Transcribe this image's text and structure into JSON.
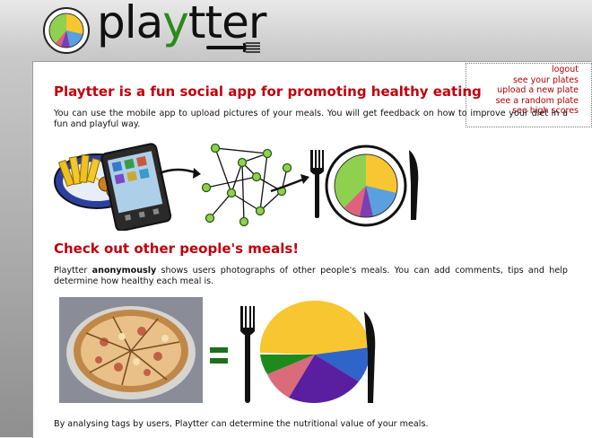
{
  "app": {
    "logo_text_a": "pla",
    "logo_text_y": "y",
    "logo_text_b": "tter",
    "logo_icon": "pie-plate-logo-icon",
    "fork_icon": "fork-icon"
  },
  "menu": {
    "logout": "logout",
    "see_plates": "see your plates",
    "upload": "upload a new plate",
    "random": "see a random plate",
    "scores": "see high scores"
  },
  "section1": {
    "heading": "Playtter is a fun social app for promoting healthy eating",
    "body": "You can use the mobile app to upload pictures of your meals. You will get feedback on how to improve your diet in a fun and playful way."
  },
  "section2": {
    "heading": "Check out other people's meals!",
    "body_pre": "Playtter ",
    "body_bold": "anonymously",
    "body_post": " shows users photographs of other people's meals. You can add comments, tips and help determine how healthy each meal is."
  },
  "section3": {
    "body": "By analysing tags by users, Playtter can determine the nutritional value of your meals."
  },
  "colors": {
    "accent_red": "#c0000d",
    "link_red": "#b30000",
    "pie_yellow": "#f7c630",
    "pie_blue": "#2f64c8",
    "pie_purple": "#5a1fa0",
    "pie_pink": "#d96b7a",
    "pie_green": "#1e8a1e",
    "equals_green": "#1e6e1e"
  },
  "icons": [
    "pie-plate-logo-icon",
    "fork-icon",
    "knife-icon",
    "phone-icon",
    "network-icon",
    "arrow-icon",
    "pizza-photo",
    "equals-icon"
  ]
}
